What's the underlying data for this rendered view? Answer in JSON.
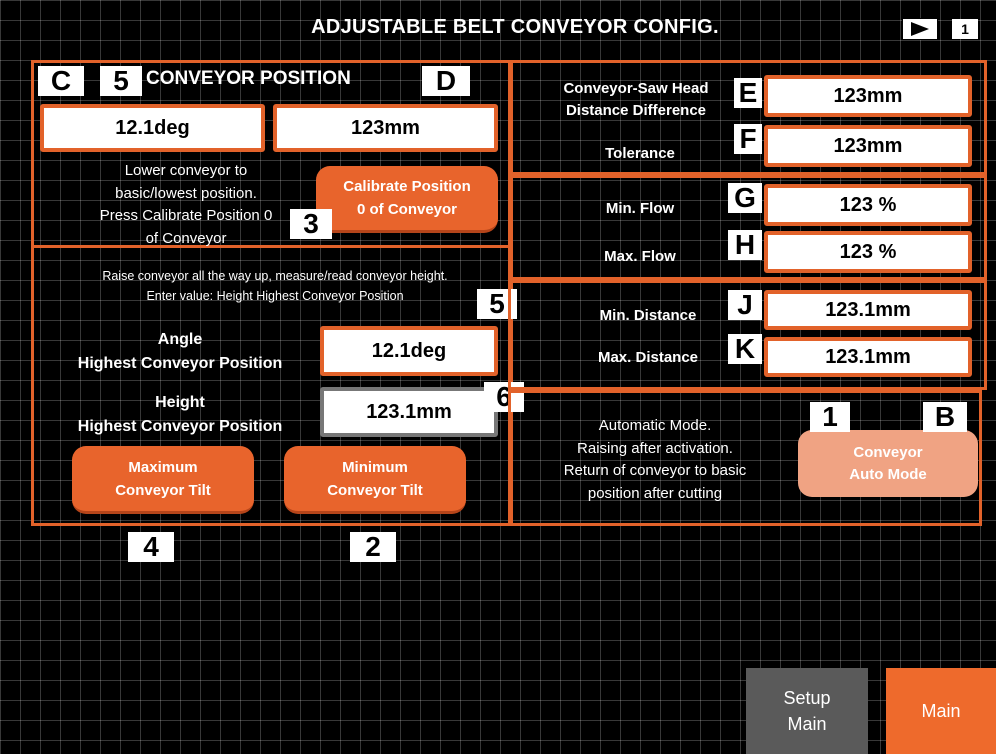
{
  "header": {
    "title": "ADJUSTABLE BELT CONVEYOR CONFIG.",
    "page_number": "1"
  },
  "tags": {
    "c": "C",
    "d": "D",
    "e": "E",
    "f": "F",
    "g": "G",
    "h": "H",
    "j": "J",
    "k": "K",
    "b": "B",
    "n5a": "5",
    "n5b": "5",
    "n3": "3",
    "n6": "6",
    "n1": "1",
    "n4": "4",
    "n2": "2"
  },
  "conveyor_position": {
    "title": "CONVEYOR POSITION",
    "angle_value": "12.1deg",
    "distance_value": "123mm",
    "instruction_lines": [
      "Lower conveyor to",
      "basic/lowest position.",
      "Press Calibrate Position 0",
      "of Conveyor"
    ],
    "calibrate_button_lines": [
      "Calibrate Position",
      "0 of Conveyor"
    ]
  },
  "highest_position": {
    "instruction_line1": "Raise conveyor all the way up, measure/read conveyor height.",
    "instruction_line2": "Enter value: Height Highest Conveyor Position",
    "angle_label_1": "Angle",
    "angle_label_2": "Highest Conveyor Position",
    "angle_value": "12.1deg",
    "height_label_1": "Height",
    "height_label_2": "Highest Conveyor Position",
    "height_value": "123.1mm",
    "max_tilt_lines": [
      "Maximum",
      "Conveyor Tilt"
    ],
    "min_tilt_lines": [
      "Minimum",
      "Conveyor Tilt"
    ]
  },
  "saw_head": {
    "diff_label_1": "Conveyor-Saw Head",
    "diff_label_2": "Distance Difference",
    "diff_value": "123mm",
    "tolerance_label": "Tolerance",
    "tolerance_value": "123mm"
  },
  "flow": {
    "min_label": "Min. Flow",
    "min_value": "123 %",
    "max_label": "Max. Flow",
    "max_value": "123 %"
  },
  "distance": {
    "min_label": "Min. Distance",
    "min_value": "123.1mm",
    "max_label": "Max. Distance",
    "max_value": "123.1mm"
  },
  "auto_mode": {
    "description_lines": [
      "Automatic Mode.",
      "Raising after activation.",
      "Return of conveyor to basic",
      "position after cutting"
    ],
    "button_lines": [
      "Conveyor",
      "Auto Mode"
    ]
  },
  "nav": {
    "setup_main_lines": [
      "Setup",
      "Main"
    ],
    "main_label": "Main"
  },
  "colors": {
    "accent": "#e2622a",
    "button": "#e8642c",
    "button_light": "#f0a383",
    "nav_grey": "#5a5a5a",
    "nav_orange": "#ee6a2c"
  }
}
